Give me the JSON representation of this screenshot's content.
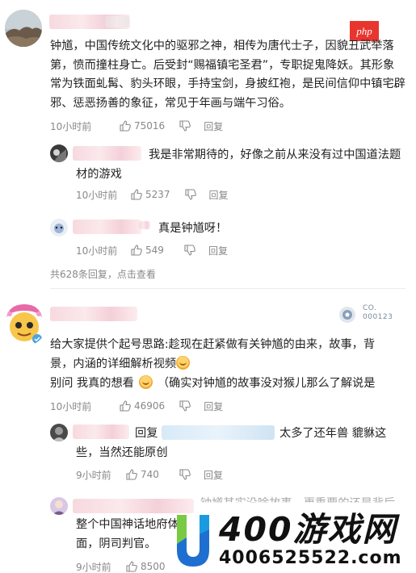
{
  "badge": {
    "label": "php"
  },
  "comment1": {
    "text": "钟馗，中国传统文化中的驱邪之神，相传为唐代士子，因貌丑武举落第，愤而撞柱身亡。后受封“赐福镇宅圣君”，专职捉鬼降妖。其形象常为铁面虬髯、豹头环眼，手持宝剑，身披红袍，是民间信仰中镇宅辟邪、惩恶扬善的象征，常见于年画与端午习俗。",
    "time": "10小时前",
    "likes": "75016",
    "reply_label": "回复",
    "replies": [
      {
        "text": "我是非常期待的，好像之前从来没有过中国道法题材的游戏",
        "time": "10小时前",
        "likes": "5237",
        "reply_label": "回复"
      },
      {
        "text": "真是钟馗呀！",
        "time": "10小时前",
        "likes": "549",
        "reply_label": "回复"
      }
    ],
    "more_replies": "共628条回复，点击查看"
  },
  "comment2": {
    "user_badge_line1": "CO.",
    "user_badge_line2": "000123",
    "text_line1": "给大家提供个起号思路:趁现在赶紧做有关钟馗的由来，故事，背",
    "text_line2": "景，内涵的详细解析视频",
    "text_line3_a": "别问 我真的想看",
    "text_line3_b": "（确实对钟馗的故事没对猴儿那么了解说是",
    "time": "10小时前",
    "likes": "46906",
    "reply_label": "回复",
    "replies": [
      {
        "prefix": "回复",
        "text_a": "太多了还年兽 貔貅这",
        "text_b": "些，当然还能原创",
        "time": "9小时前",
        "likes": "740",
        "reply_label": "回复"
      },
      {
        "text_a": "钟馗其实没啥故事，更重要的还是背后",
        "text_b": "整个中国神话地府体",
        "text_c": "面，阴司判官。",
        "time": "9小时前",
        "likes": "8500"
      }
    ]
  },
  "watermark": {
    "title": "400游戏网",
    "phone": "4006525522.com"
  }
}
